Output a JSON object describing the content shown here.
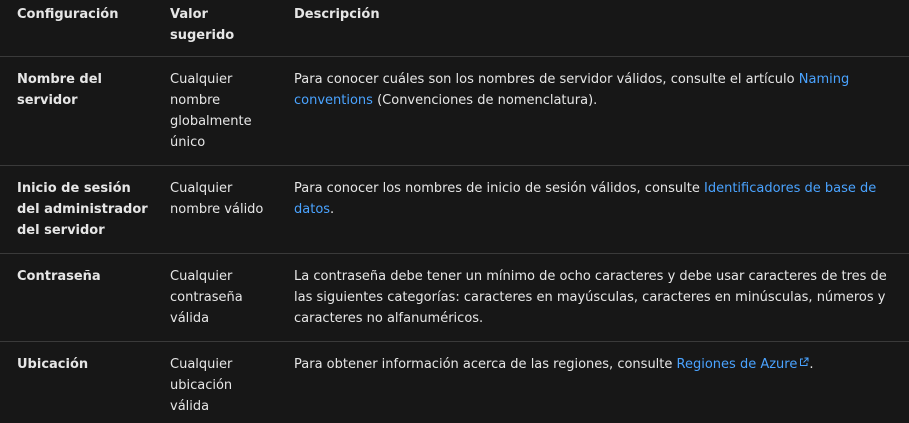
{
  "header": {
    "col1": "Configuración",
    "col2": "Valor sugerido",
    "col3": "Descripción"
  },
  "rows": [
    {
      "setting": "Nombre del servidor",
      "value": "Cualquier nombre globalmente único",
      "desc_before": "Para conocer cuáles son los nombres de servidor válidos, consulte el artículo ",
      "link": "Naming conventions",
      "desc_after": " (Convenciones de nomenclatura)."
    },
    {
      "setting": "Inicio de sesión del administrador del servidor",
      "value": "Cualquier nombre válido",
      "desc_before": "Para conocer los nombres de inicio de sesión válidos, consulte ",
      "link": "Identificadores de base de datos",
      "desc_after": "."
    },
    {
      "setting": "Contraseña",
      "value": "Cualquier contraseña válida",
      "desc": "La contraseña debe tener un mínimo de ocho caracteres y debe usar caracteres de tres de las siguientes categorías: caracteres en mayúsculas, caracteres en minúsculas, números y caracteres no alfanuméricos."
    },
    {
      "setting": "Ubicación",
      "value": "Cualquier ubicación válida",
      "desc_before": "Para obtener información acerca de las regiones, consulte ",
      "link": "Regiones de Azure",
      "link_icon": "external-link-icon",
      "desc_after": "."
    }
  ]
}
